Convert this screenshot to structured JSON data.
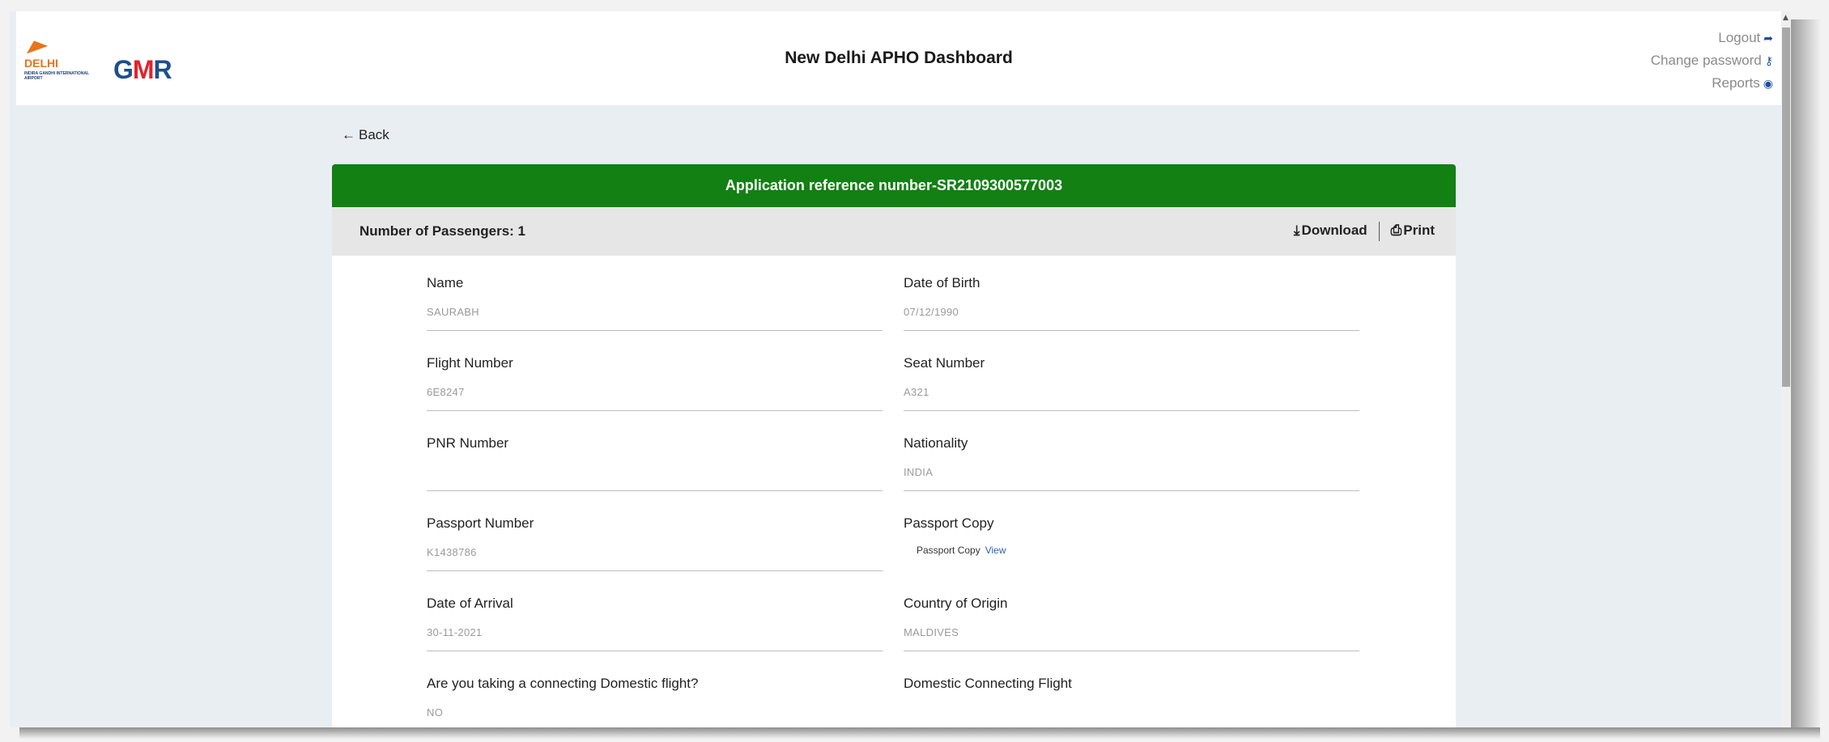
{
  "header": {
    "logo_delhi_text": "DELHI",
    "logo_delhi_sub": "INDIRA GANDHI INTERNATIONAL AIRPORT",
    "logo_gmr": "GMR",
    "title": "New Delhi APHO Dashboard",
    "links": [
      {
        "label": "Logout",
        "icon": "logout-icon"
      },
      {
        "label": "Change password",
        "icon": "key-icon"
      },
      {
        "label": "Reports",
        "icon": "eye-icon"
      }
    ]
  },
  "back_label": "Back",
  "card": {
    "title": "Application reference number-SR2109300577003",
    "passenger_count": "Number of Passengers: 1",
    "download_label": "Download",
    "print_label": "Print"
  },
  "fields": {
    "name": {
      "label": "Name",
      "value": "SAURABH"
    },
    "dob": {
      "label": "Date of Birth",
      "value": "07/12/1990"
    },
    "flight": {
      "label": "Flight Number",
      "value": "6E8247"
    },
    "seat": {
      "label": "Seat Number",
      "value": "A321"
    },
    "pnr": {
      "label": "PNR Number",
      "value": ""
    },
    "nationality": {
      "label": "Nationality",
      "value": "INDIA"
    },
    "passport_no": {
      "label": "Passport Number",
      "value": "K1438786"
    },
    "passport_copy": {
      "label": "Passport Copy",
      "value": "Passport Copy",
      "link": "View"
    },
    "arrival": {
      "label": "Date of Arrival",
      "value": "30-11-2021"
    },
    "origin": {
      "label": "Country of Origin",
      "value": "MALDIVES"
    },
    "connecting": {
      "label": "Are you taking a connecting Domestic flight?",
      "value": "NO"
    },
    "domestic_flight": {
      "label": "Domestic Connecting Flight",
      "value": ""
    }
  },
  "colors": {
    "header_green": "#138013",
    "link_blue": "#2a62b8",
    "delhi_orange": "#e8731c",
    "gmr_blue": "#1d4f8c",
    "gmr_red": "#e3232b"
  }
}
